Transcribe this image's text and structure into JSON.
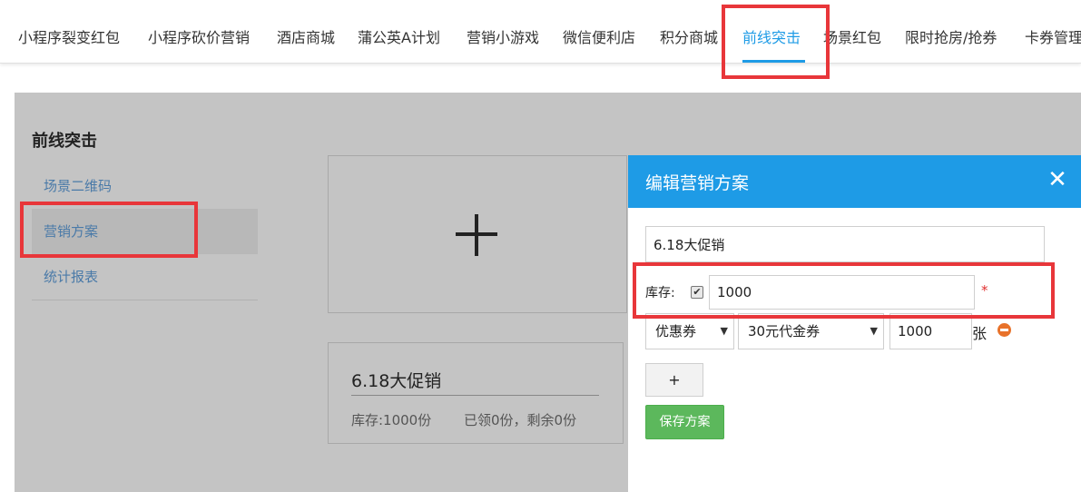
{
  "nav": {
    "items": [
      "小程序裂变红包",
      "小程序砍价营销",
      "酒店商城",
      "蒲公英A计划",
      "营销小游戏",
      "微信便利店",
      "积分商城",
      "前线突击",
      "场景红包",
      "限时抢房/抢券",
      "卡券管理"
    ],
    "active_index": 7
  },
  "sidebar": {
    "title": "前线突击",
    "items": [
      {
        "label": "场景二维码"
      },
      {
        "label": "营销方案"
      },
      {
        "label": "统计报表"
      }
    ],
    "active_index": 1
  },
  "plan_card": {
    "title": "6.18大促销",
    "stock": "库存:1000份",
    "claimed": "已领0份，剩余0份"
  },
  "modal": {
    "title": "编辑营销方案",
    "close": "✕",
    "name_value": "6.18大促销",
    "stock_label": "库存:",
    "stock_checked": true,
    "stock_value": "1000",
    "required_mark": "*",
    "type_select": "优惠券",
    "coupon_select": "30元代金券",
    "qty_value": "1000",
    "unit": "张",
    "add_row": "+",
    "save": "保存方案"
  },
  "colors": {
    "accent": "#1e9be6",
    "save_green": "#5cb85c",
    "highlight_red": "#e8363a",
    "remove_orange": "#e8722a"
  }
}
